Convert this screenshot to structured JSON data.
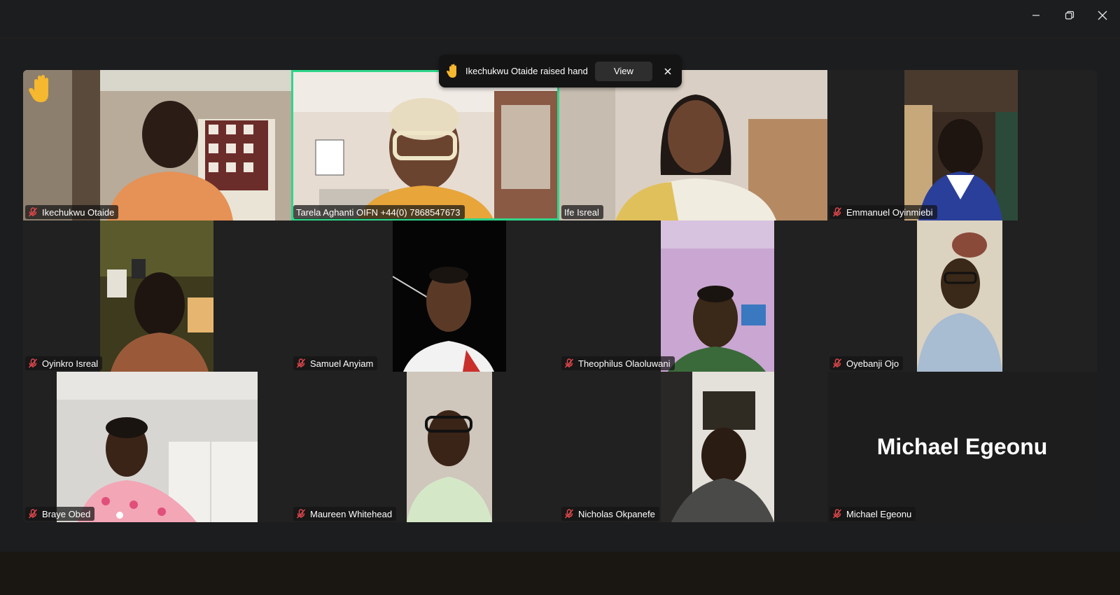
{
  "window": {
    "minimize_icon": "minimize-icon",
    "restore_icon": "restore-icon",
    "close_icon": "close-icon"
  },
  "notification": {
    "icon": "raised-hand-icon",
    "text": "Ikechukwu Otaide raised hand",
    "view_label": "View",
    "close_icon": "close-icon"
  },
  "colors": {
    "speaking_border": "#2fd68a",
    "muted_mic": "#e5484d",
    "raised_hand": "#f5b82e",
    "tile_background": "#212121"
  },
  "participants": [
    {
      "name": "Ikechukwu Otaide",
      "muted": true,
      "hand_raised": true,
      "speaking": false,
      "video": true
    },
    {
      "name": "Tarela Aghanti OIFN +44(0) 7868547673",
      "muted": false,
      "hand_raised": false,
      "speaking": true,
      "video": true
    },
    {
      "name": "Ife Isreal",
      "muted": false,
      "hand_raised": false,
      "speaking": false,
      "video": true
    },
    {
      "name": "Emmanuel Oyinmiebi",
      "muted": true,
      "hand_raised": false,
      "speaking": false,
      "video": true
    },
    {
      "name": "Oyinkro Isreal",
      "muted": true,
      "hand_raised": false,
      "speaking": false,
      "video": true
    },
    {
      "name": "Samuel Anyiam",
      "muted": true,
      "hand_raised": false,
      "speaking": false,
      "video": true
    },
    {
      "name": "Theophilus Olaoluwani",
      "muted": true,
      "hand_raised": false,
      "speaking": false,
      "video": true
    },
    {
      "name": "Oyebanji Ojo",
      "muted": true,
      "hand_raised": false,
      "speaking": false,
      "video": true
    },
    {
      "name": "Braye Obed",
      "muted": true,
      "hand_raised": false,
      "speaking": false,
      "video": true
    },
    {
      "name": "Maureen Whitehead",
      "muted": true,
      "hand_raised": false,
      "speaking": false,
      "video": true
    },
    {
      "name": "Nicholas Okpanefe",
      "muted": true,
      "hand_raised": false,
      "speaking": false,
      "video": true
    },
    {
      "name": "Michael Egeonu",
      "muted": true,
      "hand_raised": false,
      "speaking": false,
      "video": false,
      "display_name": "Michael Egeonu"
    }
  ]
}
